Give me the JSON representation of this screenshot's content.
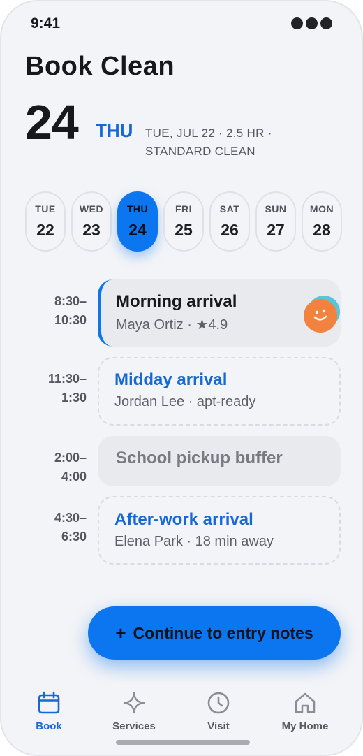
{
  "status_bar": {
    "time": "9:41"
  },
  "header": {
    "title": "Book Clean",
    "date_number": "24",
    "day_label": "THU",
    "meta": "TUE, JUL 22 · 2.5 HR · STANDARD CLEAN"
  },
  "days": [
    {
      "dow": "TUE",
      "dom": "22",
      "selected": false
    },
    {
      "dow": "WED",
      "dom": "23",
      "selected": false
    },
    {
      "dow": "THU",
      "dom": "24",
      "selected": true
    },
    {
      "dow": "FRI",
      "dom": "25",
      "selected": false
    },
    {
      "dow": "SAT",
      "dom": "26",
      "selected": false
    },
    {
      "dow": "SUN",
      "dom": "27",
      "selected": false
    },
    {
      "dow": "MON",
      "dom": "28",
      "selected": false
    }
  ],
  "slots": [
    {
      "time_start": "8:30–",
      "time_end": "10:30",
      "title": "Morning arrival",
      "subtitle": "Maya Ortiz · ★4.9",
      "status": "booked"
    },
    {
      "time_start": "11:30–",
      "time_end": "1:30",
      "title": "Midday arrival",
      "subtitle": "Jordan Lee · apt-ready",
      "status": "open"
    },
    {
      "time_start": "2:00–",
      "time_end": "4:00",
      "title": "School pickup buffer",
      "subtitle": "",
      "status": "buffer"
    },
    {
      "time_start": "4:30–",
      "time_end": "6:30",
      "title": "After-work arrival",
      "subtitle": "Elena Park · 18 min away",
      "status": "open"
    }
  ],
  "cta": {
    "icon": "plus",
    "label": "Continue to entry notes"
  },
  "tabs": [
    {
      "label": "Book",
      "icon": "calendar-icon",
      "active": true
    },
    {
      "label": "Services",
      "icon": "sparkle-icon",
      "active": false
    },
    {
      "label": "Visit",
      "icon": "clock-icon",
      "active": false
    },
    {
      "label": "My Home",
      "icon": "home-icon",
      "active": false
    }
  ],
  "colors": {
    "accent": "#0b76f0",
    "accent_text": "#1668d6",
    "background": "#f3f4f7",
    "avatar": "#f2823d"
  }
}
